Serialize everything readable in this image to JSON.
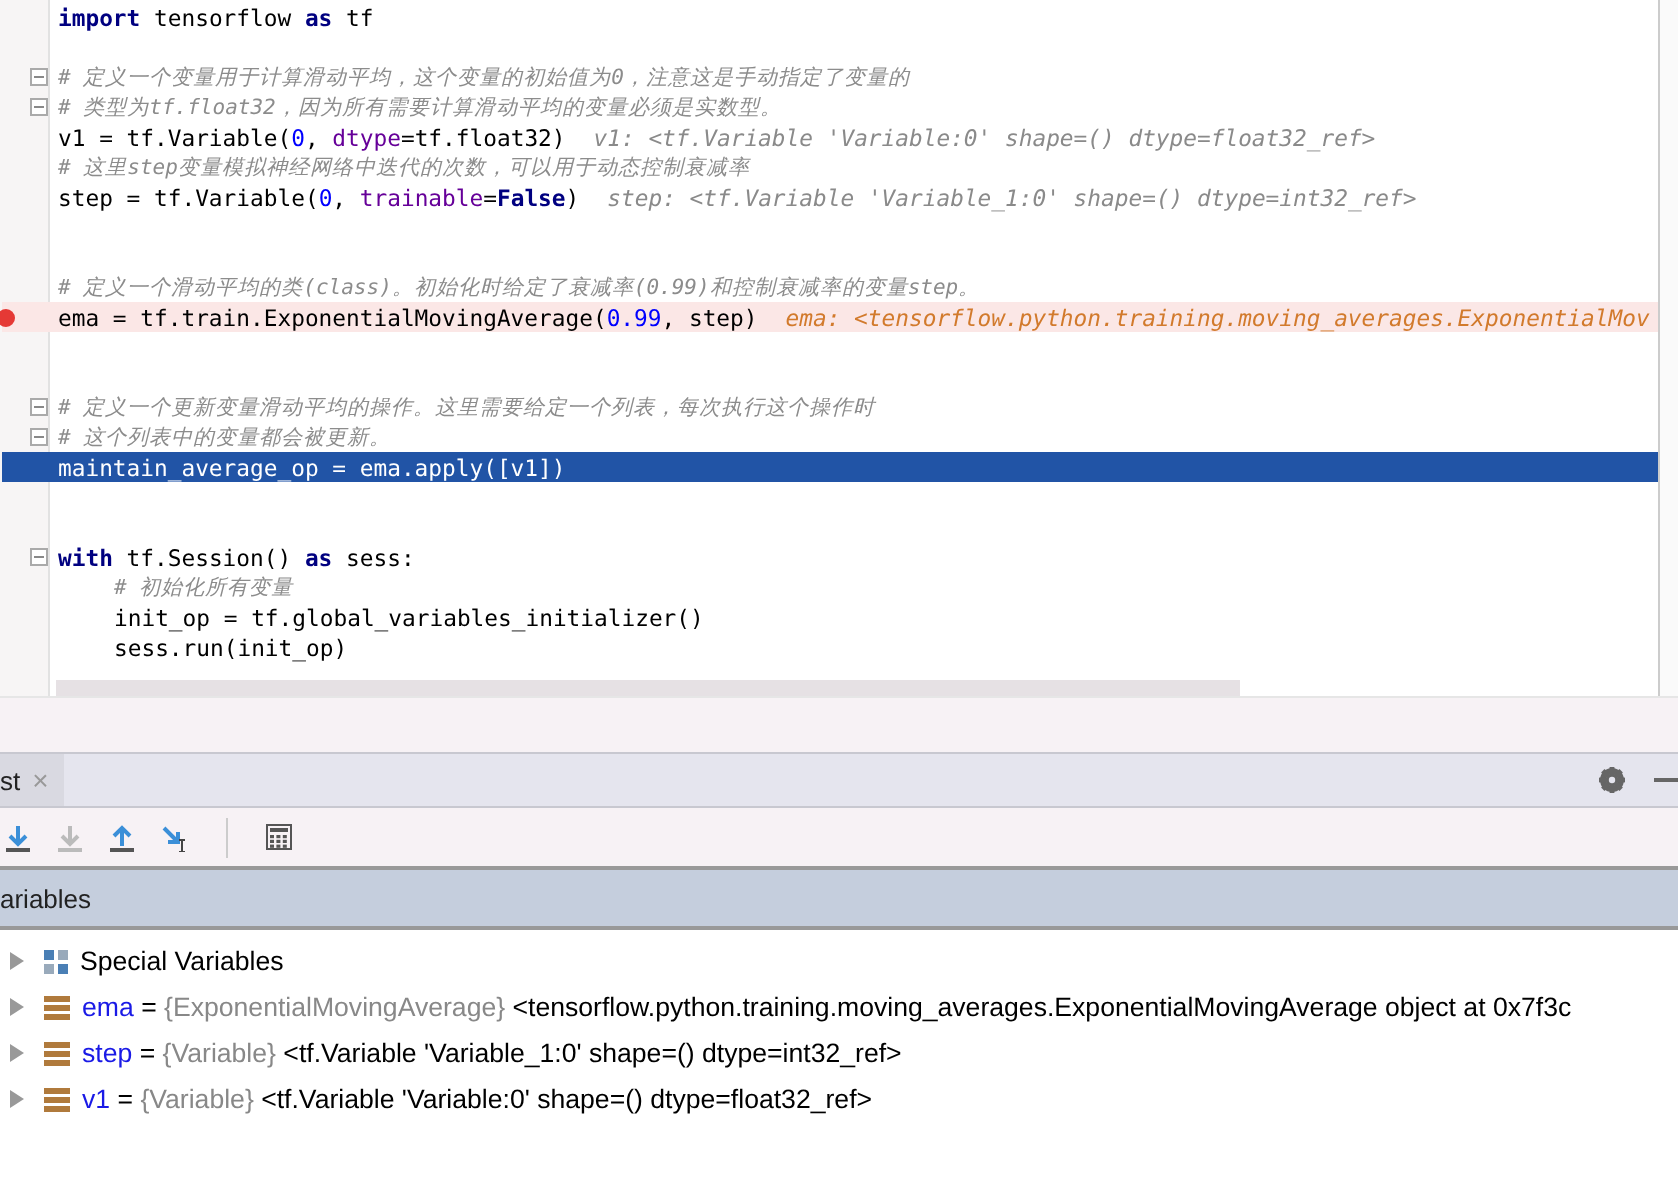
{
  "editor": {
    "lines": [
      {
        "kind": "code",
        "indented": false,
        "fold": false,
        "breakpoint": false,
        "current": false,
        "tokens": [
          {
            "kind": "kw",
            "s": "import"
          },
          {
            "kind": "plain",
            "s": " tensorflow "
          },
          {
            "kind": "kw",
            "s": "as"
          },
          {
            "kind": "plain",
            "s": " tf"
          }
        ]
      },
      {
        "kind": "blank"
      },
      {
        "kind": "code",
        "indented": false,
        "fold": true,
        "breakpoint": false,
        "current": false,
        "tokens": [
          {
            "kind": "comment",
            "s": "# 定义一个变量用于计算滑动平均，这个变量的初始值为0，注意这是手动指定了变量的"
          }
        ]
      },
      {
        "kind": "code",
        "indented": false,
        "fold": true,
        "breakpoint": false,
        "current": false,
        "tokens": [
          {
            "kind": "comment",
            "s": "# 类型为tf.float32，因为所有需要计算滑动平均的变量必须是实数型。"
          }
        ]
      },
      {
        "kind": "code",
        "indented": false,
        "fold": false,
        "breakpoint": false,
        "current": false,
        "tokens": [
          {
            "kind": "plain",
            "s": "v1 = tf.Variable("
          },
          {
            "kind": "num",
            "s": "0"
          },
          {
            "kind": "plain",
            "s": ", "
          },
          {
            "kind": "param",
            "s": "dtype"
          },
          {
            "kind": "plain",
            "s": "=tf.float32)"
          }
        ],
        "inline_value": "v1: <tf.Variable 'Variable:0' shape=() dtype=float32_ref>"
      },
      {
        "kind": "code",
        "indented": false,
        "fold": false,
        "breakpoint": false,
        "current": false,
        "tokens": [
          {
            "kind": "comment",
            "s": "# 这里step变量模拟神经网络中迭代的次数，可以用于动态控制衰减率"
          }
        ]
      },
      {
        "kind": "code",
        "indented": false,
        "fold": false,
        "breakpoint": false,
        "current": false,
        "tokens": [
          {
            "kind": "plain",
            "s": "step = tf.Variable("
          },
          {
            "kind": "num",
            "s": "0"
          },
          {
            "kind": "plain",
            "s": ", "
          },
          {
            "kind": "param",
            "s": "trainable"
          },
          {
            "kind": "plain",
            "s": "="
          },
          {
            "kind": "kw",
            "s": "False"
          },
          {
            "kind": "plain",
            "s": ")"
          }
        ],
        "inline_value": "step: <tf.Variable 'Variable_1:0' shape=() dtype=int32_ref>"
      },
      {
        "kind": "blank"
      },
      {
        "kind": "blank"
      },
      {
        "kind": "code",
        "indented": false,
        "fold": false,
        "breakpoint": false,
        "current": false,
        "tokens": [
          {
            "kind": "comment",
            "s": "# 定义一个滑动平均的类(class)。初始化时给定了衰减率(0.99)和控制衰减率的变量step。"
          }
        ]
      },
      {
        "kind": "code",
        "indented": false,
        "fold": false,
        "breakpoint": true,
        "current": false,
        "tokens": [
          {
            "kind": "plain",
            "s": "ema = tf.train.ExponentialMovingAverage("
          },
          {
            "kind": "num",
            "s": "0.99"
          },
          {
            "kind": "plain",
            "s": ", step)"
          }
        ],
        "inline_value": "ema: <tensorflow.python.training.moving_averages.ExponentialMov"
      },
      {
        "kind": "blank"
      },
      {
        "kind": "blank"
      },
      {
        "kind": "code",
        "indented": false,
        "fold": true,
        "breakpoint": false,
        "current": false,
        "tokens": [
          {
            "kind": "comment",
            "s": "# 定义一个更新变量滑动平均的操作。这里需要给定一个列表，每次执行这个操作时"
          }
        ]
      },
      {
        "kind": "code",
        "indented": false,
        "fold": true,
        "breakpoint": false,
        "current": false,
        "tokens": [
          {
            "kind": "comment",
            "s": "# 这个列表中的变量都会被更新。"
          }
        ]
      },
      {
        "kind": "code",
        "indented": false,
        "fold": false,
        "breakpoint": false,
        "current": true,
        "tokens": [
          {
            "kind": "plain",
            "s": "maintain_average_op = ema.apply([v1])"
          }
        ]
      },
      {
        "kind": "blank"
      },
      {
        "kind": "blank"
      },
      {
        "kind": "code",
        "indented": false,
        "fold": true,
        "breakpoint": false,
        "current": false,
        "tokens": [
          {
            "kind": "kw",
            "s": "with"
          },
          {
            "kind": "plain",
            "s": " tf.Session() "
          },
          {
            "kind": "kw",
            "s": "as"
          },
          {
            "kind": "plain",
            "s": " sess:"
          }
        ]
      },
      {
        "kind": "code",
        "indented": true,
        "fold": false,
        "breakpoint": false,
        "current": false,
        "tokens": [
          {
            "kind": "comment",
            "s": "# 初始化所有变量"
          }
        ]
      },
      {
        "kind": "code",
        "indented": true,
        "fold": false,
        "breakpoint": false,
        "current": false,
        "tokens": [
          {
            "kind": "plain",
            "s": "init_op = tf.global_variables_initializer()"
          }
        ]
      },
      {
        "kind": "code",
        "indented": true,
        "fold": false,
        "breakpoint": false,
        "current": false,
        "tokens": [
          {
            "kind": "plain",
            "s": "sess.run(init_op)"
          }
        ]
      }
    ]
  },
  "debug_panel": {
    "tab": {
      "label": "st",
      "close": "×"
    },
    "toolbar": [
      {
        "kind": "step-over",
        "disabled": false
      },
      {
        "kind": "step-into",
        "disabled": true
      },
      {
        "kind": "step-out",
        "disabled": false
      },
      {
        "kind": "run-to-cursor",
        "disabled": false
      },
      {
        "kind": "separator"
      },
      {
        "kind": "evaluate"
      }
    ],
    "variables_header": "ariables",
    "variables": [
      {
        "kind": "special",
        "label": "Special Variables"
      },
      {
        "kind": "var",
        "name": "ema",
        "separator": "=",
        "type": "{ExponentialMovingAverage}",
        "value": "<tensorflow.python.training.moving_averages.ExponentialMovingAverage object at 0x7f3c"
      },
      {
        "kind": "var",
        "name": "step",
        "separator": "=",
        "type": "{Variable}",
        "value": "<tf.Variable 'Variable_1:0' shape=() dtype=int32_ref>"
      },
      {
        "kind": "var",
        "name": "v1",
        "separator": "=",
        "type": "{Variable}",
        "value": "<tf.Variable 'Variable:0' shape=() dtype=float32_ref>"
      }
    ]
  }
}
